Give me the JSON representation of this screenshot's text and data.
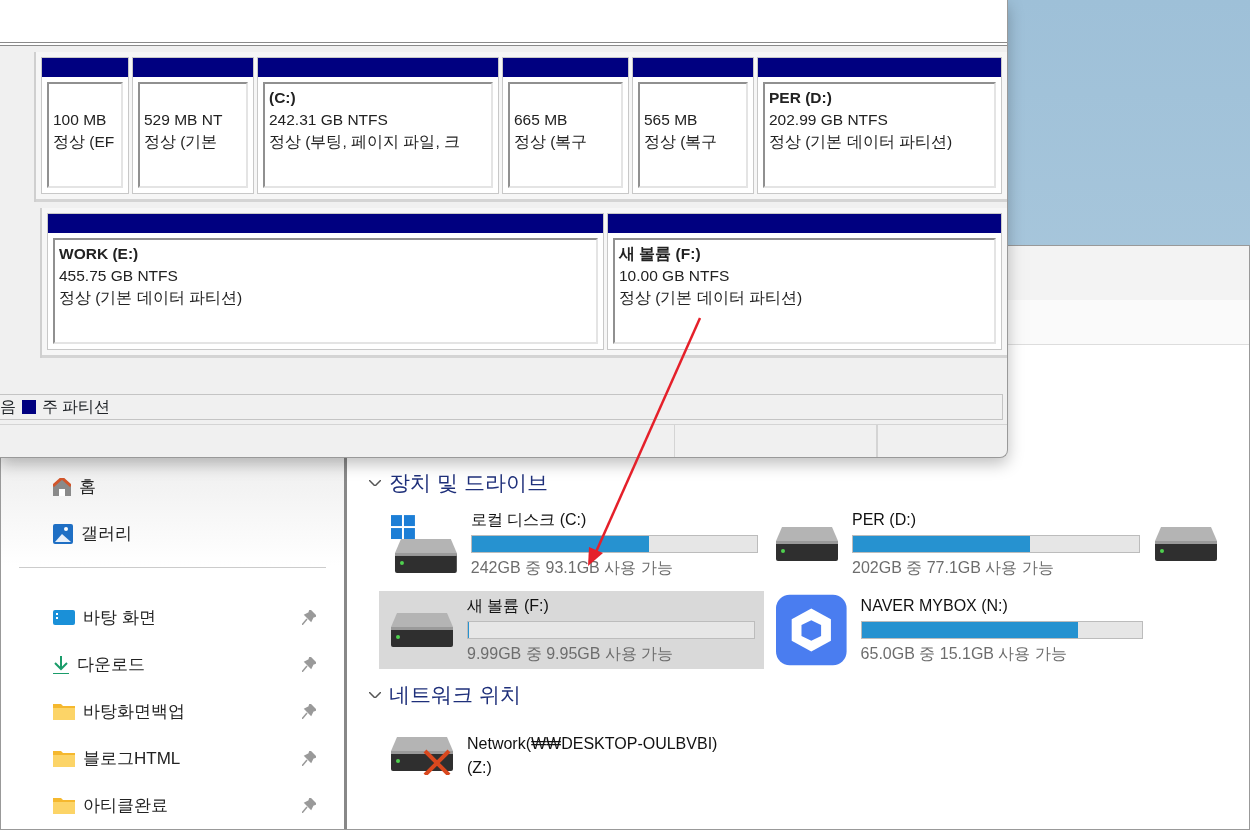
{
  "disk_management": {
    "disks": [
      {
        "partitions": [
          {
            "size": "100 MB",
            "status": "정상 (EF"
          },
          {
            "size": "529 MB NT",
            "status": "정상 (기본"
          },
          {
            "name": "(C:)",
            "size": "242.31 GB NTFS",
            "status": "정상 (부팅, 페이지 파일, 크"
          },
          {
            "size": "665 MB",
            "status": "정상 (복구"
          },
          {
            "size": "565 MB",
            "status": "정상 (복구"
          },
          {
            "name": "PER  (D:)",
            "size": "202.99 GB NTFS",
            "status": "정상 (기본 데이터 파티션)"
          }
        ]
      },
      {
        "partitions": [
          {
            "name": "WORK  (E:)",
            "size": "455.75 GB NTFS",
            "status": "정상 (기본 데이터 파티션)"
          },
          {
            "name": "새 볼륨  (F:)",
            "size": "10.00 GB NTFS",
            "status": "정상 (기본 데이터 파티션)"
          }
        ]
      }
    ],
    "legend": [
      {
        "label": "음"
      },
      {
        "label": "주 파티션",
        "color": "#000080"
      }
    ]
  },
  "explorer": {
    "sidebar": {
      "items": [
        {
          "label": "홈",
          "kind": "home"
        },
        {
          "label": "갤러리",
          "kind": "gallery"
        }
      ],
      "pinned": [
        {
          "label": "바탕 화면",
          "kind": "desktop",
          "pinned": true
        },
        {
          "label": "다운로드",
          "kind": "download",
          "pinned": true
        },
        {
          "label": "바탕화면백업",
          "kind": "folder",
          "pinned": true
        },
        {
          "label": "블로그HTML",
          "kind": "folder",
          "pinned": true
        },
        {
          "label": "아티클완료",
          "kind": "folder",
          "pinned": true
        }
      ]
    },
    "sections": [
      {
        "title": "장치 및 드라이브",
        "expanded": true,
        "items": [
          {
            "name": "로컬 디스크 (C:)",
            "kind": "windows-drive",
            "level": 0.62,
            "reading": "242GB 중 93.1GB 사용 가능",
            "selected": false
          },
          {
            "name": "PER (D:)",
            "kind": "drive",
            "level": 0.62,
            "reading": "202GB 중 77.1GB 사용 가능",
            "selected": false
          },
          {
            "kind": "drive",
            "selected": false
          },
          {
            "name": "새 볼륨 (F:)",
            "kind": "drive",
            "level": 0.005,
            "reading": "9.99GB 중 9.95GB 사용 가능",
            "selected": true
          },
          {
            "name": "NAVER MYBOX (N:)",
            "kind": "cloud-box",
            "level": 0.77,
            "reading": "65.0GB 중 15.1GB 사용 가능",
            "selected": false
          }
        ]
      },
      {
        "title": "네트워크 위치",
        "expanded": true,
        "items": [
          {
            "name": "Network(₩₩DESKTOP-OULBVBI)",
            "sub": "(Z:)",
            "kind": "network-drive-off",
            "selected": false
          }
        ]
      }
    ]
  }
}
